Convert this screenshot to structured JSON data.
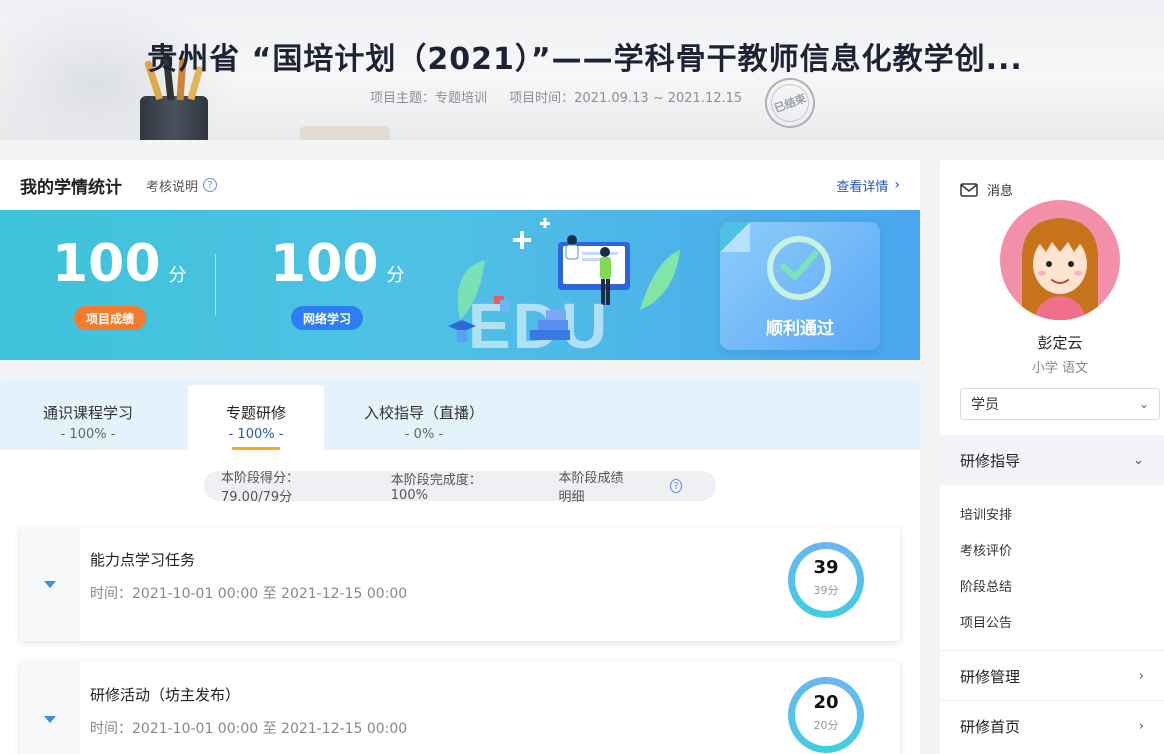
{
  "banner": {
    "title": "贵州省 “国培计划（2021）”——学科骨干教师信息化教学创...",
    "theme": "项目主题：专题培训",
    "period": "项目时间：2021.09.13 ~ 2021.12.15",
    "stamp": "已结束"
  },
  "stats": {
    "title": "我的学情统计",
    "exam_note": "考核说明",
    "view_detail": "查看详情",
    "project_score": "100",
    "project_unit": "分",
    "project_tag": "项目成绩",
    "online_score": "100",
    "online_unit": "分",
    "online_tag": "网络学习",
    "illus_text": "EDU",
    "pass_text": "顺利通过"
  },
  "tabs": [
    {
      "label": "通识课程学习",
      "pct": "- 100% -"
    },
    {
      "label": "专题研修",
      "pct": "- 100% -"
    },
    {
      "label": "入校指导（直播）",
      "pct": "- 0% -"
    }
  ],
  "stage": {
    "score": "本阶段得分：79.00/79分",
    "completion": "本阶段完成度：100%",
    "detail": "本阶段成绩明细"
  },
  "tasks": [
    {
      "name": "能力点学习任务",
      "time": "时间：2021-10-01 00:00 至 2021-12-15 00:00",
      "score": "39",
      "score_sub": "39分"
    },
    {
      "name": "研修活动（坊主发布）",
      "time": "时间：2021-10-01 00:00 至 2021-12-15 00:00",
      "score": "20",
      "score_sub": "20分"
    }
  ],
  "sidebar": {
    "message": "消息",
    "user_name": "彭定云",
    "user_sub": "小学  语文",
    "role": "学员",
    "groups": [
      {
        "label": "研修指导",
        "items": [
          "培训安排",
          "考核评价",
          "阶段总结",
          "项目公告"
        ]
      },
      {
        "label": "研修管理"
      },
      {
        "label": "研修首页"
      }
    ]
  },
  "colors": {
    "accent": "#2a56b8",
    "project_tag": "#f47a2c",
    "online_tag": "#2d7ef0",
    "tab_underline": "#f5a623"
  }
}
